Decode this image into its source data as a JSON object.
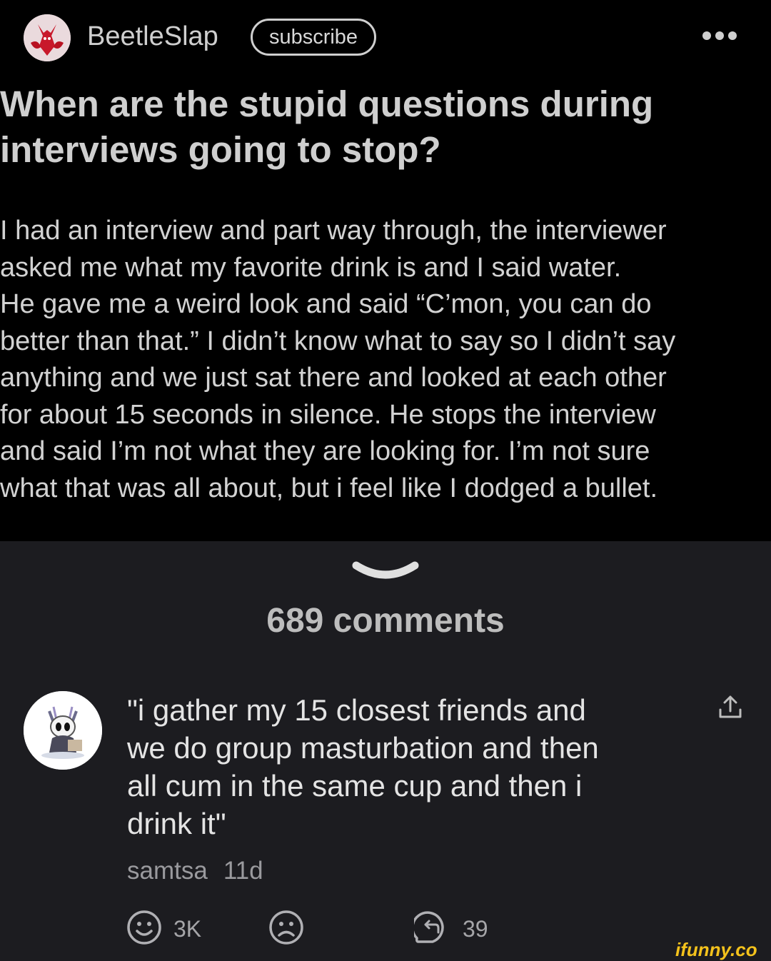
{
  "post": {
    "username": "BeetleSlap",
    "subscribe_label": "subscribe",
    "title_lines": [
      "When are the stupid questions during",
      "interviews going to stop?"
    ],
    "body_lines": [
      "I had an interview and part way through, the interviewer",
      "asked me what my favorite drink is and I said water.",
      "He gave me a weird look and said “C’mon, you can do",
      "better than that.” I didn’t know what to say so I didn’t say",
      "anything and we just sat there and looked at each other",
      "for about 15 seconds in silence. He stops the interview",
      "and said I’m not what they are looking for. I’m not sure",
      "what that was all about, but i feel like I dodged a bullet."
    ]
  },
  "comments_header": "689 comments",
  "comment": {
    "text_lines": [
      "\"i gather my 15 closest friends and",
      "we do group masturbation and then",
      "all cum in the same cup and then i",
      "drink it\""
    ],
    "author": "samtsa",
    "time": "11d",
    "smile_count": "3K",
    "reply_count": "39"
  },
  "watermark": "ifunny.co",
  "colors": {
    "post_bg": "#000000",
    "comments_bg": "#1c1c20",
    "watermark": "#f4c21c"
  },
  "icons": [
    "more-icon",
    "chevron-down-icon",
    "share-icon",
    "smile-icon",
    "frown-icon",
    "reply-icon"
  ]
}
